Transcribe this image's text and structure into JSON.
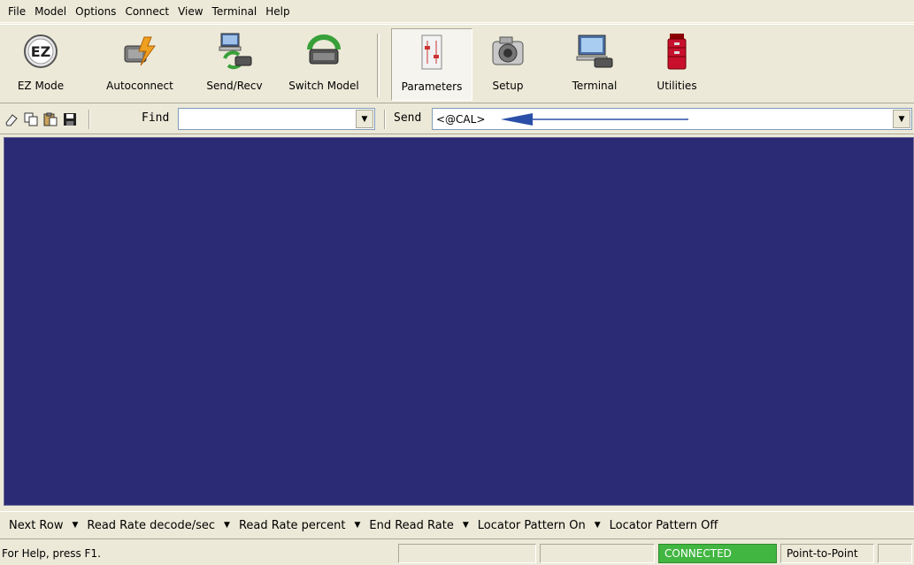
{
  "menu": [
    "File",
    "Model",
    "Options",
    "Connect",
    "View",
    "Terminal",
    "Help"
  ],
  "toolbar": {
    "ez_mode": "EZ Mode",
    "autoconnect": "Autoconnect",
    "send_recv": "Send/Recv",
    "switch_model": "Switch Model",
    "parameters": "Parameters",
    "setup": "Setup",
    "terminal": "Terminal",
    "utilities": "Utilities"
  },
  "findbar": {
    "find_label": "Find",
    "find_value": "",
    "send_label": "Send",
    "send_value": "<@CAL>"
  },
  "macros": [
    "Next Row",
    "Read Rate decode/sec",
    "Read Rate percent",
    "End Read Rate",
    "Locator Pattern On",
    "Locator Pattern Off"
  ],
  "status": {
    "help_text": "For Help, press F1.",
    "connection": "CONNECTED",
    "mode": "Point-to-Point"
  },
  "colors": {
    "terminal_bg": "#2b2a74",
    "connected_bg": "#41b641",
    "arrow": "#2a4fa8"
  },
  "icons": {
    "ez_mode": "ez-logo-icon",
    "autoconnect": "connector-lightning-icon",
    "send_recv": "computer-exchange-icon",
    "switch_model": "device-cycle-icon",
    "parameters": "parameters-switch-icon",
    "setup": "camera-icon",
    "terminal": "monitor-icon",
    "utilities": "toolbox-icon"
  }
}
